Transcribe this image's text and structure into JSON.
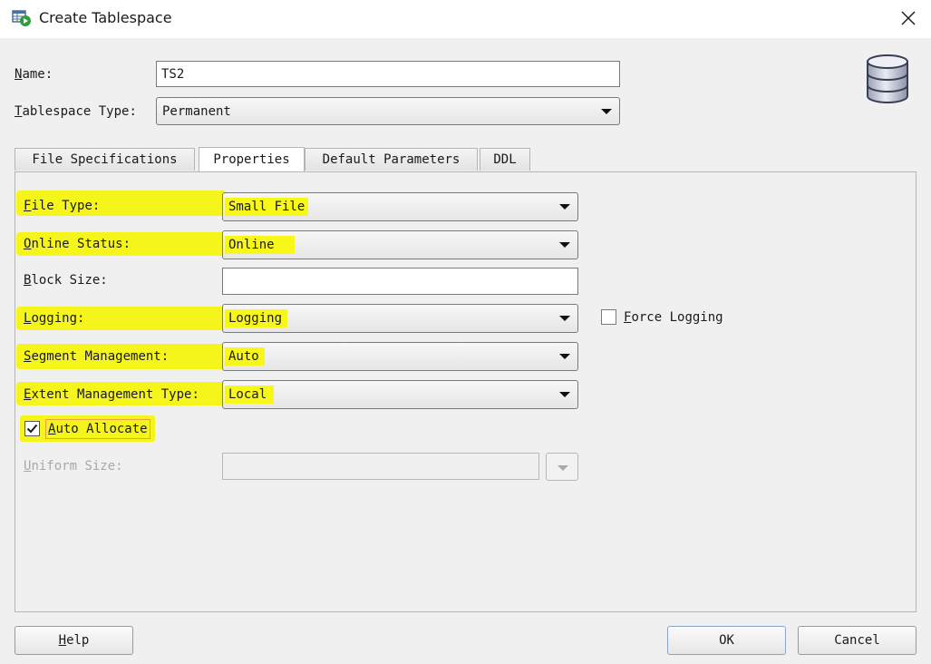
{
  "window": {
    "title": "Create Tablespace"
  },
  "header": {
    "name_label_mnemonic": "N",
    "name_label_rest": "ame:",
    "name_value": "TS2",
    "type_label_mnemonic": "T",
    "type_label_rest": "ablespace Type:",
    "type_value": "Permanent"
  },
  "tabs": [
    {
      "label": "File Specifications"
    },
    {
      "label": "Properties"
    },
    {
      "label": "Default Parameters"
    },
    {
      "label": "DDL"
    }
  ],
  "properties": {
    "file_type_mnemonic": "F",
    "file_type_rest": "ile Type:",
    "file_type_value": "Small File",
    "online_status_mnemonic": "O",
    "online_status_rest": "nline Status:",
    "online_status_value": "Online",
    "block_size_mnemonic": "B",
    "block_size_rest": "lock Size:",
    "block_size_value": "",
    "logging_mnemonic": "L",
    "logging_rest": "ogging:",
    "logging_value": "Logging",
    "force_logging_mnemonic": "F",
    "force_logging_rest": "orce Logging",
    "force_logging_checked": false,
    "segment_mgmt_mnemonic": "S",
    "segment_mgmt_rest": "egment Management:",
    "segment_mgmt_value": "Auto",
    "extent_mgmt_mnemonic": "E",
    "extent_mgmt_rest": "xtent Management Type:",
    "extent_mgmt_value": "Local",
    "auto_allocate_mnemonic": "A",
    "auto_allocate_rest": "uto Allocate",
    "auto_allocate_checked": true,
    "uniform_size_mnemonic": "U",
    "uniform_size_rest": "niform Size:",
    "uniform_size_value": ""
  },
  "footer": {
    "help_mnemonic": "H",
    "help_rest": "elp",
    "ok_label": "OK",
    "cancel_label": "Cancel"
  },
  "colors": {
    "highlight": "#f5f51c",
    "checkbox_outline": "#e8a33c"
  },
  "icons": {
    "title": "tablespace-app-icon",
    "close": "close-icon",
    "database": "database-icon"
  }
}
